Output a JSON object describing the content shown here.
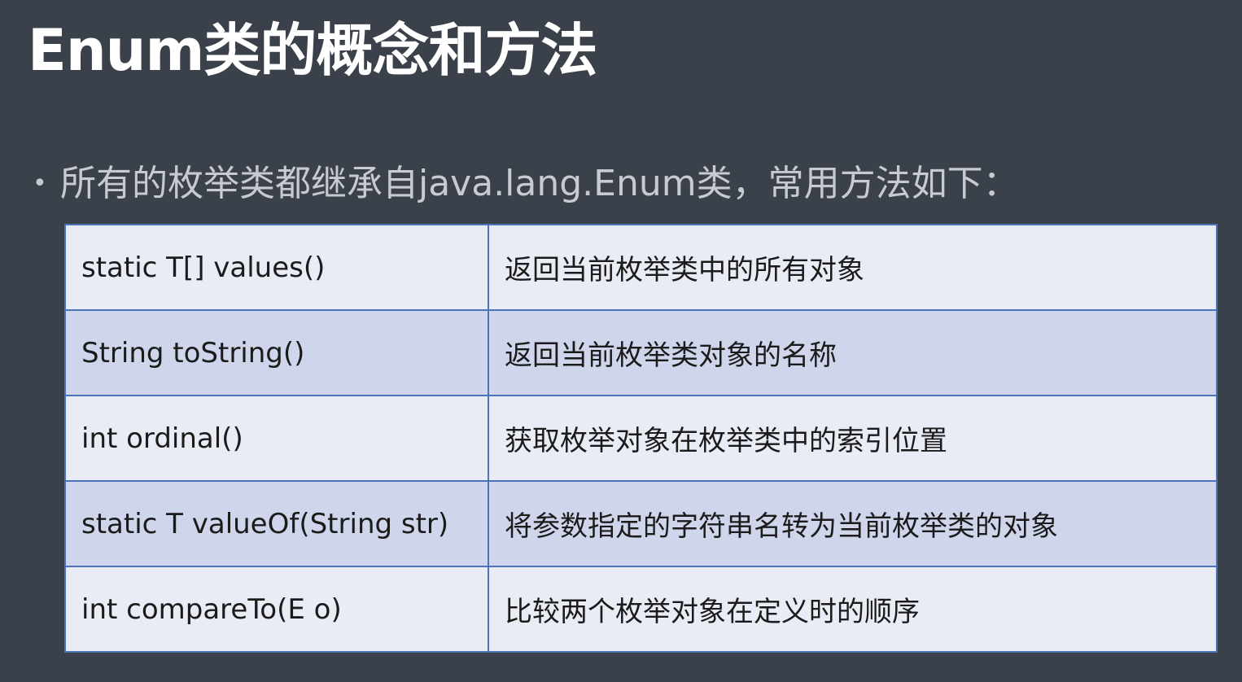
{
  "title": "Enum类的概念和方法",
  "bullet": {
    "symbol": "•",
    "text": "所有的枚举类都继承自java.lang.Enum类，常用方法如下："
  },
  "table": {
    "rows": [
      {
        "signature": "static T[] values()",
        "description": "返回当前枚举类中的所有对象"
      },
      {
        "signature": "String toString()",
        "description": "返回当前枚举类对象的名称"
      },
      {
        "signature": "int ordinal()",
        "description": "获取枚举对象在枚举类中的索引位置"
      },
      {
        "signature": "static T valueOf(String str)",
        "description": "将参数指定的字符串名转为当前枚举类的对象"
      },
      {
        "signature": "int compareTo(E o)",
        "description": "比较两个枚举对象在定义时的顺序"
      }
    ]
  },
  "colors": {
    "background": "#3b414a",
    "title": "#ffffff",
    "bullet_text": "#c7cacf",
    "row_light": "#e9ebf5",
    "row_dark": "#cfd5ea",
    "table_border": "#4a73b8"
  }
}
